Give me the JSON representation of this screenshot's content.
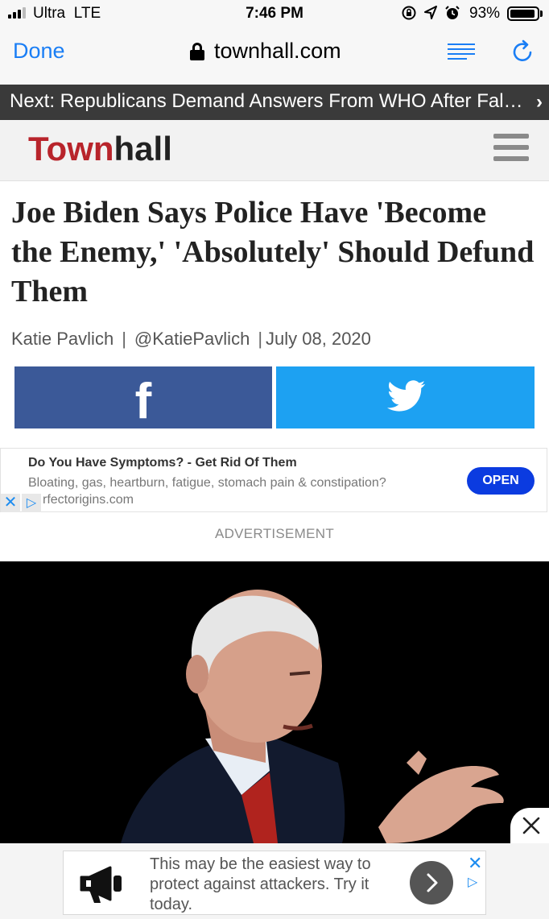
{
  "status_bar": {
    "carrier": "Ultra",
    "network": "LTE",
    "time": "7:46 PM",
    "battery_percent": "93%",
    "battery_level": 0.93,
    "icons": [
      "orientation-lock-icon",
      "location-icon",
      "alarm-icon"
    ]
  },
  "browser": {
    "done_label": "Done",
    "url": "townhall.com"
  },
  "next_bar": {
    "text": "Next: Republicans Demand Answers From WHO After Fals..."
  },
  "site": {
    "logo_part1": "Town",
    "logo_part2": "hall",
    "brand_color": "#b8242b"
  },
  "article": {
    "headline": "Joe Biden Says Police Have 'Become the Enemy,' 'Absolutely' Should Defund Them",
    "author": "Katie Pavlich",
    "handle": "@KatiePavlich",
    "date": "July 08, 2020"
  },
  "share": {
    "facebook_color": "#3b5998",
    "twitter_color": "#1da1f2"
  },
  "ad": {
    "title": "Do You Have Symptoms? - Get Rid Of Them",
    "description": "Bloating, gas, heartburn, fatigue, stomach pain & constipation?",
    "domain": "rfectorigins.com",
    "cta": "OPEN",
    "label": "ADVERTISEMENT"
  },
  "bottom_ad": {
    "text": "This may be the easiest way to protect against attackers. Try it today."
  }
}
